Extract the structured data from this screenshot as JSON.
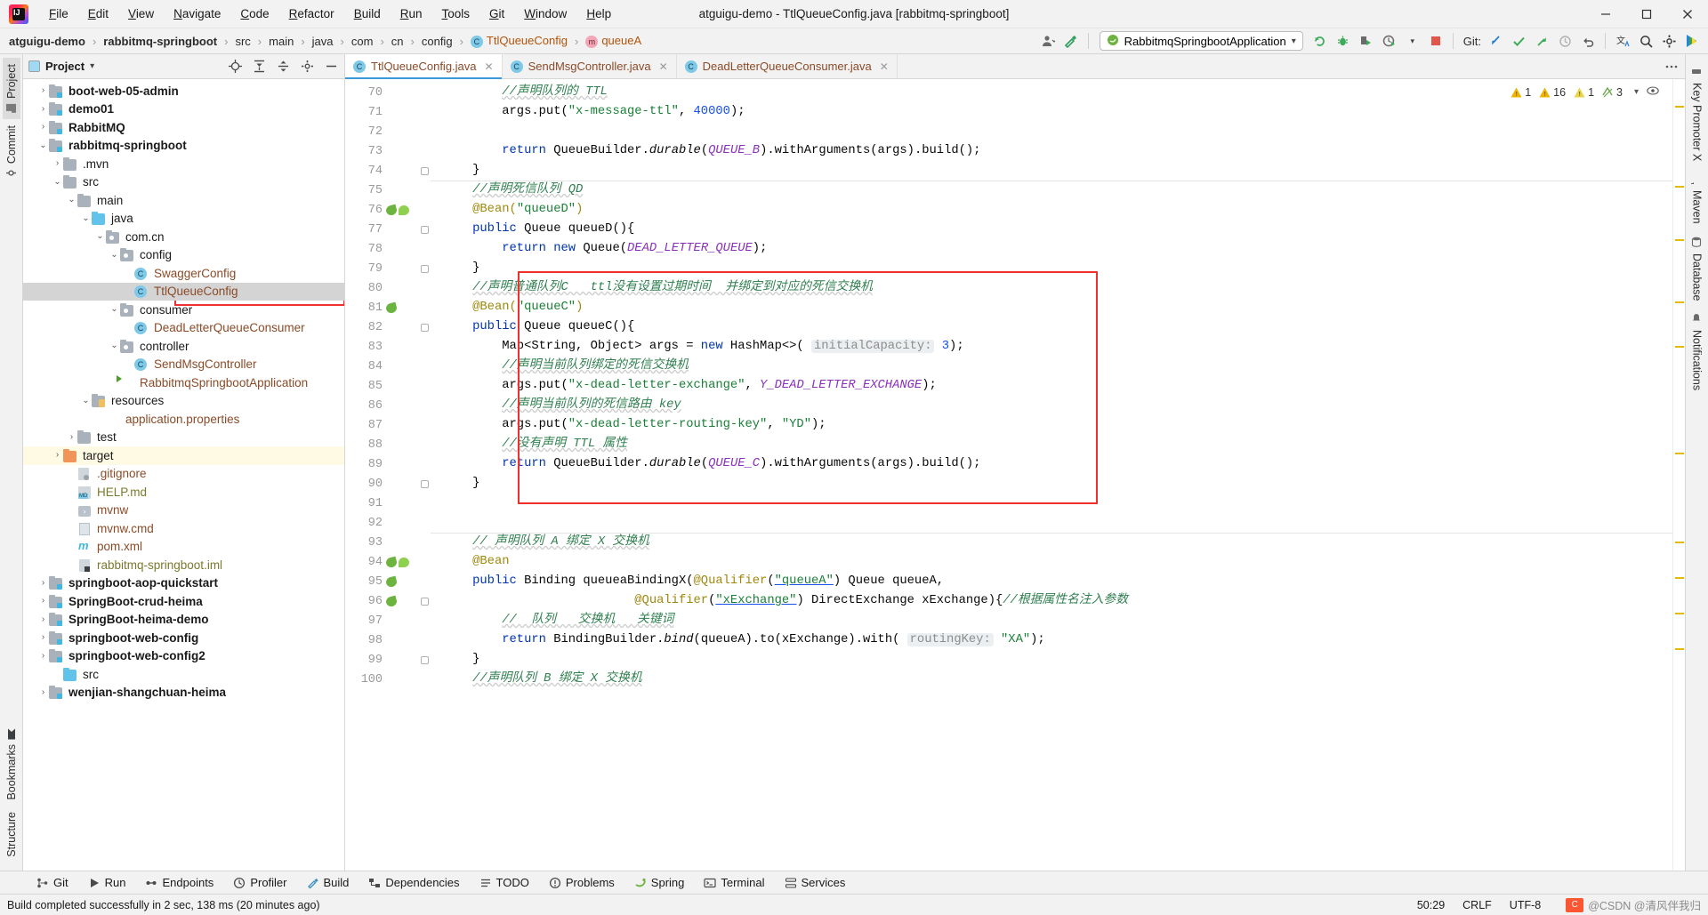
{
  "window": {
    "title": "atguigu-demo - TtlQueueConfig.java [rabbitmq-springboot]",
    "minimize": "—",
    "maximize": "❑",
    "close": "✕"
  },
  "menubar": [
    {
      "label": "File"
    },
    {
      "label": "Edit"
    },
    {
      "label": "View"
    },
    {
      "label": "Navigate"
    },
    {
      "label": "Code"
    },
    {
      "label": "Refactor"
    },
    {
      "label": "Build"
    },
    {
      "label": "Run"
    },
    {
      "label": "Tools"
    },
    {
      "label": "Git"
    },
    {
      "label": "Window"
    },
    {
      "label": "Help"
    }
  ],
  "breadcrumbs": [
    {
      "label": "atguigu-demo",
      "bold": true,
      "icon": ""
    },
    {
      "label": "rabbitmq-springboot",
      "bold": true,
      "icon": ""
    },
    {
      "label": "src",
      "bold": false,
      "icon": ""
    },
    {
      "label": "main",
      "bold": false,
      "icon": ""
    },
    {
      "label": "java",
      "bold": false,
      "icon": ""
    },
    {
      "label": "com",
      "bold": false,
      "icon": ""
    },
    {
      "label": "cn",
      "bold": false,
      "icon": ""
    },
    {
      "label": "config",
      "bold": false,
      "icon": ""
    },
    {
      "label": "TtlQueueConfig",
      "bold": false,
      "icon": "class-icon",
      "icon_letter": "C",
      "orange": true
    },
    {
      "label": "queueA",
      "bold": false,
      "icon": "method-icon",
      "icon_letter": "m",
      "orange": true
    }
  ],
  "toolbar": {
    "run_config": "RabbitmqSpringbootApplication",
    "run_config_caret": "▾",
    "git_label": "Git:",
    "icons": [
      "user-avatar-icon",
      "hammer-build-icon",
      "rerun-icon",
      "debug-icon",
      "run-with-coverage-icon",
      "profiler-icon",
      "stop-icon",
      "git-update-icon",
      "git-commit-icon",
      "git-push-icon",
      "git-history-icon",
      "git-rollback-icon",
      "translate-icon",
      "search-icon",
      "settings-icon",
      "ide-helper-icon"
    ]
  },
  "left_strip": {
    "tabs": [
      {
        "label": "Project",
        "active": true,
        "icon": "project-icon"
      },
      {
        "label": "Commit",
        "active": false,
        "icon": "commit-icon"
      }
    ],
    "bottom_tabs": [
      {
        "label": "Bookmarks",
        "icon": "bookmark-icon"
      },
      {
        "label": "Structure",
        "icon": "structure-icon"
      }
    ]
  },
  "right_strip": {
    "tabs": [
      {
        "label": "Key Promoter X",
        "icon": "key-promoter-icon"
      },
      {
        "label": "Maven",
        "icon": "maven-icon"
      },
      {
        "label": "Database",
        "icon": "database-icon"
      },
      {
        "label": "Notifications",
        "icon": "notifications-icon"
      }
    ]
  },
  "project_panel": {
    "title": "Project",
    "dropdown_caret": "▾",
    "actions": [
      "locate-icon",
      "expand-all-icon",
      "collapse-all-icon",
      "settings-icon",
      "hide-icon"
    ],
    "tree": [
      {
        "indent": 1,
        "arrow": "›",
        "icon": "module-folder-icon",
        "label": "boot-web-05-admin",
        "style": "b"
      },
      {
        "indent": 1,
        "arrow": "›",
        "icon": "module-folder-icon",
        "label": "demo01",
        "style": "b"
      },
      {
        "indent": 1,
        "arrow": "›",
        "icon": "module-folder-icon",
        "label": "RabbitMQ",
        "style": "b"
      },
      {
        "indent": 1,
        "arrow": "⌄",
        "icon": "module-folder-icon",
        "label": "rabbitmq-springboot",
        "style": "b"
      },
      {
        "indent": 2,
        "arrow": "›",
        "icon": "folder-icon",
        "label": ".mvn",
        "style": ""
      },
      {
        "indent": 2,
        "arrow": "⌄",
        "icon": "folder-icon",
        "label": "src",
        "style": ""
      },
      {
        "indent": 3,
        "arrow": "⌄",
        "icon": "folder-icon",
        "label": "main",
        "style": ""
      },
      {
        "indent": 4,
        "arrow": "⌄",
        "icon": "folder-blue-icon",
        "label": "java",
        "style": ""
      },
      {
        "indent": 5,
        "arrow": "⌄",
        "icon": "package-icon",
        "label": "com.cn",
        "style": ""
      },
      {
        "indent": 6,
        "arrow": "⌄",
        "icon": "package-icon",
        "label": "config",
        "style": ""
      },
      {
        "indent": 7,
        "arrow": "",
        "icon": "class-icon",
        "label": "SwaggerConfig",
        "style": "brown"
      },
      {
        "indent": 7,
        "arrow": "",
        "icon": "class-icon",
        "label": "TtlQueueConfig",
        "style": "brown",
        "selected": true,
        "boxed": true
      },
      {
        "indent": 6,
        "arrow": "⌄",
        "icon": "package-icon",
        "label": "consumer",
        "style": ""
      },
      {
        "indent": 7,
        "arrow": "",
        "icon": "class-icon",
        "label": "DeadLetterQueueConsumer",
        "style": "brown"
      },
      {
        "indent": 6,
        "arrow": "⌄",
        "icon": "package-icon",
        "label": "controller",
        "style": ""
      },
      {
        "indent": 7,
        "arrow": "",
        "icon": "class-icon",
        "label": "SendMsgController",
        "style": "brown"
      },
      {
        "indent": 6,
        "arrow": "",
        "icon": "spring-class-icon",
        "label": "RabbitmqSpringbootApplication",
        "style": "brown"
      },
      {
        "indent": 4,
        "arrow": "⌄",
        "icon": "resources-folder-icon",
        "label": "resources",
        "style": ""
      },
      {
        "indent": 5,
        "arrow": "",
        "icon": "spring-leaf-icon",
        "label": "application.properties",
        "style": "brown"
      },
      {
        "indent": 3,
        "arrow": "›",
        "icon": "folder-icon",
        "label": "test",
        "style": ""
      },
      {
        "indent": 2,
        "arrow": "›",
        "icon": "folder-orange-icon",
        "label": "target",
        "style": "",
        "highlight": true
      },
      {
        "indent": 3,
        "arrow": "",
        "icon": "gitignore-icon",
        "label": ".gitignore",
        "style": "brown"
      },
      {
        "indent": 3,
        "arrow": "",
        "icon": "markdown-icon",
        "label": "HELP.md",
        "style": "olive"
      },
      {
        "indent": 3,
        "arrow": "",
        "icon": "shell-icon",
        "label": "mvnw",
        "style": "brown"
      },
      {
        "indent": 3,
        "arrow": "",
        "icon": "text-file-icon",
        "label": "mvnw.cmd",
        "style": "brown"
      },
      {
        "indent": 3,
        "arrow": "",
        "icon": "maven-pom-icon",
        "label": "pom.xml",
        "style": "brown"
      },
      {
        "indent": 3,
        "arrow": "",
        "icon": "iml-icon",
        "label": "rabbitmq-springboot.iml",
        "style": "olive"
      },
      {
        "indent": 1,
        "arrow": "›",
        "icon": "module-folder-icon",
        "label": "springboot-aop-quickstart",
        "style": "b"
      },
      {
        "indent": 1,
        "arrow": "›",
        "icon": "module-folder-icon",
        "label": "SpringBoot-crud-heima",
        "style": "b"
      },
      {
        "indent": 1,
        "arrow": "›",
        "icon": "module-folder-icon",
        "label": "SpringBoot-heima-demo",
        "style": "b"
      },
      {
        "indent": 1,
        "arrow": "›",
        "icon": "module-folder-icon",
        "label": "springboot-web-config",
        "style": "b"
      },
      {
        "indent": 1,
        "arrow": "›",
        "icon": "module-folder-icon",
        "label": "springboot-web-config2",
        "style": "b"
      },
      {
        "indent": 2,
        "arrow": "",
        "icon": "folder-blue-icon",
        "label": "src",
        "style": ""
      },
      {
        "indent": 1,
        "arrow": "›",
        "icon": "module-folder-icon",
        "label": "wenjian-shangchuan-heima",
        "style": "b"
      }
    ]
  },
  "editor": {
    "tabs": [
      {
        "label": "TtlQueueConfig.java",
        "active": true,
        "icon": "class-icon",
        "close": "✕"
      },
      {
        "label": "SendMsgController.java",
        "active": false,
        "icon": "class-icon",
        "close": "✕"
      },
      {
        "label": "DeadLetterQueueConsumer.java",
        "active": false,
        "icon": "class-icon",
        "close": "✕"
      }
    ],
    "inspections": [
      {
        "icon": "warning-icon",
        "count": "1",
        "color": "#f0b400"
      },
      {
        "icon": "warning-icon",
        "count": "16",
        "color": "#f0b400"
      },
      {
        "icon": "weak-warning-icon",
        "count": "1",
        "color": "#e8d44d"
      },
      {
        "icon": "typo-icon",
        "count": "3",
        "color": "#6aa84f"
      }
    ],
    "lines": [
      {
        "n": 70,
        "marks": [],
        "text": "        //声明队列的 TTL",
        "kind": "comment"
      },
      {
        "n": 71,
        "marks": [],
        "html": "        args.put(<s>\"x-message-ttl\"</s>, <d>40000</d>);"
      },
      {
        "n": 72,
        "marks": [],
        "html": ""
      },
      {
        "n": 73,
        "marks": [],
        "html": "        <k>return</k> QueueBuilder.<i>durable</i>(<c>QUEUE_B</c>).withArguments(args).build();"
      },
      {
        "n": 74,
        "marks": [],
        "html": "    }",
        "fold": true
      },
      {
        "n": 75,
        "marks": [],
        "text": "//声明死信队列 QD",
        "kind": "comment-indent4"
      },
      {
        "n": 76,
        "marks": [
          "bean-nav",
          "spring-bean"
        ],
        "html": "    <a>@Bean(<s2>\"queueD\"</s2>)</a>"
      },
      {
        "n": 77,
        "marks": [],
        "html": "    <k>public</k> Queue queueD(){",
        "fold": true
      },
      {
        "n": 78,
        "marks": [],
        "html": "        <k>return</k> <k>new</k> Queue(<c>DEAD_LETTER_QUEUE</c>);"
      },
      {
        "n": 79,
        "marks": [],
        "html": "    }",
        "fold": true
      },
      {
        "n": 80,
        "marks": [],
        "text": "//声明普通队列C   ttl没有设置过期时间  并绑定到对应的死信交换机",
        "kind": "comment-indent4"
      },
      {
        "n": 81,
        "marks": [
          "bean-nav"
        ],
        "html": "    <a>@Bean(<s2>\"queueC\"</s2>)</a>"
      },
      {
        "n": 82,
        "marks": [],
        "html": "    <k>public</k> Queue queueC(){",
        "fold": true
      },
      {
        "n": 83,
        "marks": [],
        "html": "        Map&lt;String, Object&gt; args = <k>new</k> HashMap&lt;&gt;( <h>initialCapacity:</h> <d>3</d>);"
      },
      {
        "n": 84,
        "marks": [],
        "text": "    //声明当前队列绑定的死信交换机",
        "kind": "comment-indent8"
      },
      {
        "n": 85,
        "marks": [],
        "html": "        args.put(<s>\"x-dead-letter-exchange\"</s>, <c>Y_DEAD_LETTER_EXCHANGE</c>);"
      },
      {
        "n": 86,
        "marks": [],
        "text": "    //声明当前队列的死信路由 key",
        "kind": "comment-indent8"
      },
      {
        "n": 87,
        "marks": [],
        "html": "        args.put(<s>\"x-dead-letter-routing-key\"</s>, <s>\"YD\"</s>);"
      },
      {
        "n": 88,
        "marks": [],
        "text": "    //没有声明 TTL 属性",
        "kind": "comment-indent8"
      },
      {
        "n": 89,
        "marks": [],
        "html": "        <k>return</k> QueueBuilder.<i>durable</i>(<c>QUEUE_C</c>).withArguments(args).build();"
      },
      {
        "n": 90,
        "marks": [],
        "html": "    }",
        "fold": true
      },
      {
        "n": 91,
        "marks": [],
        "html": ""
      },
      {
        "n": 92,
        "marks": [],
        "html": ""
      },
      {
        "n": 93,
        "marks": [],
        "text": "// 声明队列 A 绑定 X 交换机",
        "kind": "comment-indent4"
      },
      {
        "n": 94,
        "marks": [
          "bean-nav",
          "spring-bean"
        ],
        "html": "    <a>@Bean</a>"
      },
      {
        "n": 95,
        "marks": [
          "bean-nav"
        ],
        "html": "    <k>public</k> Binding queueaBindingX(<a>@Qualifier</a>(<s><u>\"queueA\"</u></s>) Queue queueA,"
      },
      {
        "n": 96,
        "marks": [
          "bean-nav"
        ],
        "html": "                          <a>@Qualifier</a>(<s><u>\"xExchange\"</u></s>) DirectExchange xExchange){<cm>//根据属性名注入参数</cm>",
        "fold": true
      },
      {
        "n": 97,
        "marks": [],
        "text": "    //  队列   交换机   关键词",
        "kind": "comment-indent8"
      },
      {
        "n": 98,
        "marks": [],
        "html": "        <k>return</k> BindingBuilder.<i>bind</i>(queueA).to(xExchange).with( <h>routingKey:</h> <s>\"XA\"</s>);"
      },
      {
        "n": 99,
        "marks": [],
        "html": "    }",
        "fold": true
      },
      {
        "n": 100,
        "marks": [],
        "text": "//声明队列 B 绑定 X 交换机",
        "kind": "comment-indent4"
      }
    ]
  },
  "tool_windows": [
    {
      "label": "Git",
      "icon": "git-icon"
    },
    {
      "label": "Run",
      "icon": "run-icon"
    },
    {
      "label": "Endpoints",
      "icon": "endpoints-icon"
    },
    {
      "label": "Profiler",
      "icon": "profiler-icon"
    },
    {
      "label": "Build",
      "icon": "build-icon"
    },
    {
      "label": "Dependencies",
      "icon": "dependencies-icon"
    },
    {
      "label": "TODO",
      "icon": "todo-icon"
    },
    {
      "label": "Problems",
      "icon": "problems-icon"
    },
    {
      "label": "Spring",
      "icon": "spring-icon"
    },
    {
      "label": "Terminal",
      "icon": "terminal-icon"
    },
    {
      "label": "Services",
      "icon": "services-icon"
    }
  ],
  "statusbar": {
    "message": "Build completed successfully in 2 sec, 138 ms (20 minutes ago)",
    "caret": "50:29",
    "line_separator": "CRLF",
    "encoding": "UTF-8",
    "indent": "",
    "watermark": "@CSDN @清风伴我归"
  }
}
